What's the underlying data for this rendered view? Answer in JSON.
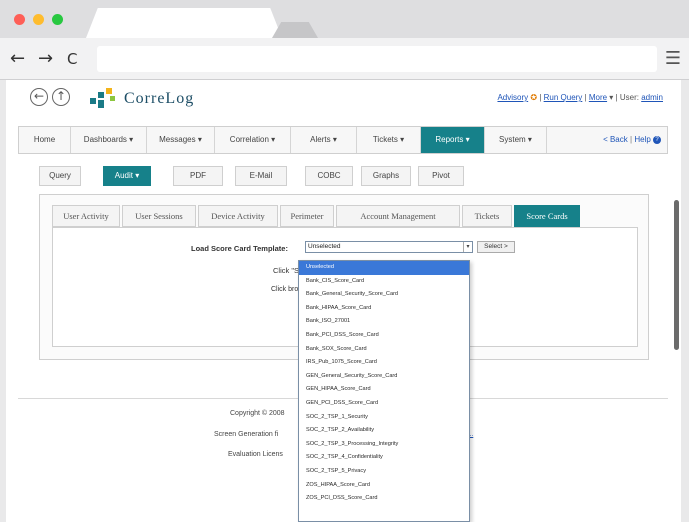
{
  "browser": {
    "back_glyph": "←",
    "forward_glyph": "→",
    "reload_glyph": "C",
    "menu_glyph": "☰",
    "url": ""
  },
  "app": {
    "logo_text": "CorreLog",
    "back_glyph": "←",
    "forward_glyph": "↑",
    "toplinks": {
      "advisory": "Advisory",
      "run_query": "Run Query",
      "more": "More",
      "user_label": "User:",
      "user_name": "admin"
    }
  },
  "mainnav": {
    "items": [
      {
        "label": "Home"
      },
      {
        "label": "Dashboards"
      },
      {
        "label": "Messages"
      },
      {
        "label": "Correlation"
      },
      {
        "label": "Alerts"
      },
      {
        "label": "Tickets"
      },
      {
        "label": "Reports"
      },
      {
        "label": "System"
      }
    ],
    "back_link": "< Back",
    "help_link": "Help"
  },
  "subnav": {
    "items": [
      {
        "label": "Query"
      },
      {
        "label": "Audit"
      },
      {
        "label": "PDF"
      },
      {
        "label": "E-Mail"
      },
      {
        "label": "COBC"
      },
      {
        "label": "Graphs"
      },
      {
        "label": "Pivot"
      }
    ]
  },
  "tabs": {
    "items": [
      {
        "label": "User Activity"
      },
      {
        "label": "User Sessions"
      },
      {
        "label": "Device Activity"
      },
      {
        "label": "Perimeter"
      },
      {
        "label": "Account Management"
      },
      {
        "label": "Tickets"
      },
      {
        "label": "Score Cards"
      }
    ]
  },
  "scorecard": {
    "load_label": "Load Score Card Template:",
    "selected_value": "Unselected",
    "select_button": "Select >",
    "hint1": "Click \"Sel",
    "hint2": "Click brows"
  },
  "dropdown": {
    "options": [
      "Unselected",
      "Bank_CIS_Score_Card",
      "Bank_General_Security_Score_Card",
      "Bank_HIPAA_Score_Card",
      "Bank_ISO_27001",
      "Bank_PCI_DSS_Score_Card",
      "Bank_SOX_Score_Card",
      "IRS_Pub_1075_Score_Card",
      "GEN_General_Security_Score_Card",
      "GEN_HIPAA_Score_Card",
      "GEN_PCI_DSS_Score_Card",
      "SOC_2_TSP_1_Security",
      "SOC_2_TSP_2_Availability",
      "SOC_2_TSP_3_Processing_Integrity",
      "SOC_2_TSP_4_Confidentiality",
      "SOC_2_TSP_5_Privacy",
      "ZOS_HIPAA_Score_Card",
      "ZOS_PCI_DSS_Score_Card"
    ],
    "selected_index": 0
  },
  "footer": {
    "copyright": "Copyright © 2008",
    "screen_gen": "Screen Generation fi",
    "eval": "Evaluation Licens",
    "link": "Is..."
  },
  "colors": {
    "accent": "#16818a",
    "selection": "#3a78d8",
    "link": "#1f55b8"
  }
}
